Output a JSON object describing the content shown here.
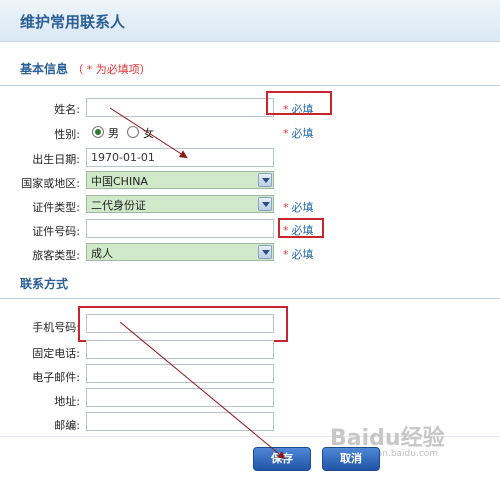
{
  "page": {
    "title": "维护常用联系人"
  },
  "basic": {
    "heading": "基本信息",
    "required_note": "（ * 为必填项）",
    "name": {
      "label": "姓名:",
      "value": ""
    },
    "gender": {
      "label": "性别:",
      "male": "男",
      "female": "女",
      "selected": "男"
    },
    "birthdate": {
      "label": "出生日期:",
      "value": "1970-01-01"
    },
    "country": {
      "label": "国家或地区:",
      "value": "中国CHINA"
    },
    "id_type": {
      "label": "证件类型:",
      "value": "二代身份证"
    },
    "id_number": {
      "label": "证件号码:",
      "value": ""
    },
    "traveler_type": {
      "label": "旅客类型:",
      "value": "成人"
    },
    "required_star": "*",
    "required_text": "必填"
  },
  "contact": {
    "heading": "联系方式",
    "mobile": {
      "label": "手机号码:",
      "value": ""
    },
    "phone": {
      "label": "固定电话:",
      "value": ""
    },
    "email": {
      "label": "电子邮件:",
      "value": ""
    },
    "address": {
      "label": "地址:",
      "value": ""
    },
    "postcode": {
      "label": "邮编:",
      "value": ""
    }
  },
  "actions": {
    "save": "保存",
    "cancel": "取消"
  },
  "watermark": {
    "brand": "Baidu经验",
    "url": "jingyan.baidu.com"
  },
  "colors": {
    "accent": "#2b5f96",
    "highlight": "#c8252c",
    "button": "#1f55a8",
    "select_bg": "#cfe9c9"
  }
}
